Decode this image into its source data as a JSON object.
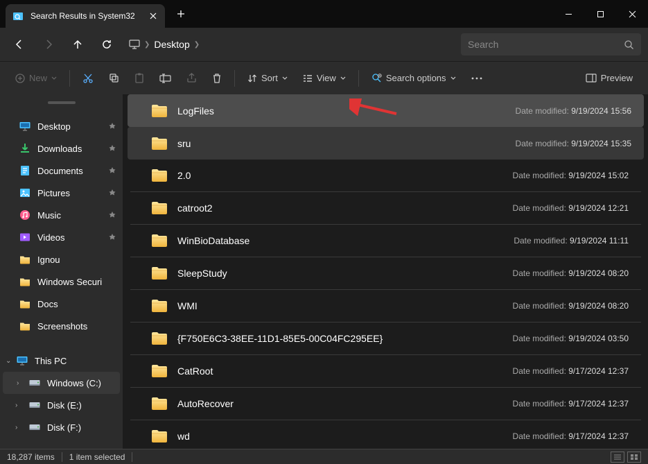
{
  "titlebar": {
    "tab_title": "Search Results in System32"
  },
  "navbar": {
    "breadcrumb": "Desktop",
    "search_placeholder": "Search"
  },
  "toolbar": {
    "new": "New",
    "sort": "Sort",
    "view": "View",
    "search_options": "Search options",
    "preview": "Preview"
  },
  "sidebar": {
    "quick": [
      {
        "label": "Desktop",
        "pinned": true,
        "icon": "desktop"
      },
      {
        "label": "Downloads",
        "pinned": true,
        "icon": "download"
      },
      {
        "label": "Documents",
        "pinned": true,
        "icon": "document"
      },
      {
        "label": "Pictures",
        "pinned": true,
        "icon": "picture"
      },
      {
        "label": "Music",
        "pinned": true,
        "icon": "music"
      },
      {
        "label": "Videos",
        "pinned": true,
        "icon": "video"
      },
      {
        "label": "Ignou",
        "pinned": false,
        "icon": "folder"
      },
      {
        "label": "Windows Securi",
        "pinned": false,
        "icon": "folder"
      },
      {
        "label": "Docs",
        "pinned": false,
        "icon": "folder"
      },
      {
        "label": "Screenshots",
        "pinned": false,
        "icon": "folder"
      }
    ],
    "thispc": "This PC",
    "drives": [
      {
        "label": "Windows (C:)",
        "selected": true,
        "icon": "drive"
      },
      {
        "label": "Disk (E:)",
        "selected": false,
        "icon": "drive"
      },
      {
        "label": "Disk (F:)",
        "selected": false,
        "icon": "drive"
      }
    ]
  },
  "files": {
    "date_label": "Date modified:",
    "items": [
      {
        "name": "LogFiles",
        "date": "9/19/2024 15:56",
        "state": "selected",
        "arrow": true
      },
      {
        "name": "sru",
        "date": "9/19/2024 15:35",
        "state": "hover"
      },
      {
        "name": "2.0",
        "date": "9/19/2024 15:02",
        "state": ""
      },
      {
        "name": "catroot2",
        "date": "9/19/2024 12:21",
        "state": ""
      },
      {
        "name": "WinBioDatabase",
        "date": "9/19/2024 11:11",
        "state": ""
      },
      {
        "name": "SleepStudy",
        "date": "9/19/2024 08:20",
        "state": ""
      },
      {
        "name": "WMI",
        "date": "9/19/2024 08:20",
        "state": ""
      },
      {
        "name": "{F750E6C3-38EE-11D1-85E5-00C04FC295EE}",
        "date": "9/19/2024 03:50",
        "state": ""
      },
      {
        "name": "CatRoot",
        "date": "9/17/2024 12:37",
        "state": ""
      },
      {
        "name": "AutoRecover",
        "date": "9/17/2024 12:37",
        "state": ""
      },
      {
        "name": "wd",
        "date": "9/17/2024 12:37",
        "state": ""
      }
    ]
  },
  "status": {
    "count": "18,287 items",
    "selection": "1 item selected"
  }
}
